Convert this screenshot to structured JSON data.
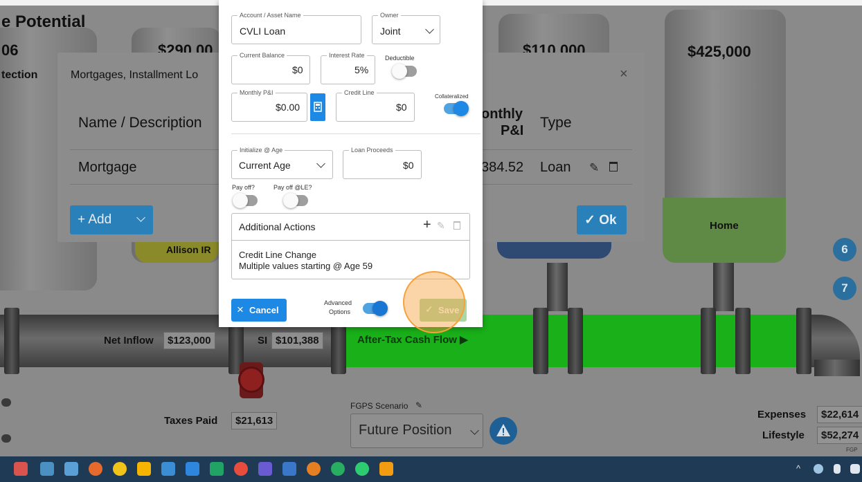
{
  "background": {
    "partial_title": "e Potential",
    "partial_year": "06",
    "partial_protection": "tection",
    "tank_values": [
      "$290,00",
      "$110,000",
      "$425,000"
    ],
    "home_label": "Home",
    "allison_label": "Allison IR",
    "net_inflow_label": "Net Inflow",
    "net_inflow_value": "$123,000",
    "si_label": "SI",
    "si_value": "$101,388",
    "after_tax_label": "After-Tax Cash Flow ▶",
    "taxes_paid_label": "Taxes Paid",
    "taxes_paid_value": "$21,613",
    "fgps_label": "FGPS Scenario",
    "fgps_value": "Future Position",
    "expenses_label": "Expenses",
    "expenses_value": "$22,614",
    "lifestyle_label": "Lifestyle",
    "lifestyle_value": "$52,274",
    "fgp_small": "FGP",
    "badges": [
      "6",
      "7"
    ]
  },
  "mortgages_dialog": {
    "title": "Mortgages, Installment Lo",
    "col_name": "Name / Description",
    "col_monthly_1": "onthly",
    "col_monthly_2": "P&I",
    "col_type": "Type",
    "row_name": "Mortgage",
    "row_monthly": "384.52",
    "row_type": "Loan",
    "add_label": "+ Add",
    "ok_label": "✓ Ok",
    "close": "×"
  },
  "edit_modal": {
    "account_legend": "Account / Asset Name",
    "account_value": "CVLI Loan",
    "owner_legend": "Owner",
    "owner_value": "Joint",
    "current_balance_legend": "Current Balance",
    "current_balance_value": "$0",
    "interest_rate_legend": "Interest Rate",
    "interest_rate_value": "5%",
    "deductible_label": "Deductible",
    "monthly_pi_legend": "Monthly P&I",
    "monthly_pi_value": "$0.00",
    "credit_line_legend": "Credit Line",
    "credit_line_value": "$0",
    "collateralized_label": "Collateralized",
    "initialize_legend": "Initialize @ Age",
    "initialize_value": "Current Age",
    "loan_proceeds_legend": "Loan Proceeds",
    "loan_proceeds_value": "$0",
    "payoff_label": "Pay off?",
    "payoff_le_label": "Pay off @LE?",
    "additional_actions_title": "Additional Actions",
    "additional_action_line1": "Credit Line Change",
    "additional_action_line2": "Multiple values starting @ Age 59",
    "cancel_label": "Cancel",
    "advanced_label_1": "Advanced",
    "advanced_label_2": "Options",
    "save_label": "Save",
    "toggles": {
      "deductible": false,
      "collateralized": true,
      "pay_off": false,
      "pay_off_le": false,
      "advanced": true
    }
  },
  "colors": {
    "accent": "#1e88e5",
    "flow": "#19b019",
    "highlight": "#f7a13c"
  }
}
